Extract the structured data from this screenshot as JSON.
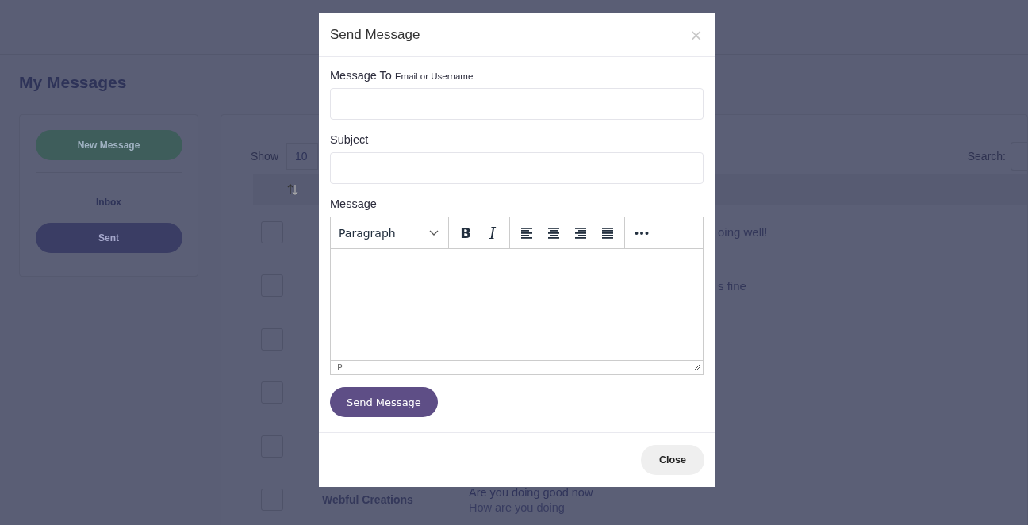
{
  "page": {
    "title": "My Messages",
    "sidebar": {
      "new_button": "New Message",
      "folders": [
        {
          "label": "Inbox",
          "selected": false
        },
        {
          "label": "Sent",
          "selected": true
        }
      ]
    },
    "table": {
      "show_label": "Show",
      "page_size": "10",
      "search_label": "Search:",
      "rows": [
        {
          "checked": false,
          "fragment": "oing well!"
        },
        {
          "checked": false,
          "fragment": "s fine"
        },
        {
          "checked": false
        },
        {
          "checked": false
        },
        {
          "checked": false
        },
        {
          "checked": false,
          "sender": "Webful Creations",
          "subject": "Are you doing good now",
          "preview": "How are you doing"
        }
      ]
    }
  },
  "modal": {
    "title": "Send Message",
    "close": "×",
    "fields": [
      {
        "label": "Message To",
        "hint": "Email or Username"
      },
      {
        "label": "Subject"
      }
    ],
    "message_label": "Message",
    "editor": {
      "block_format": "Paragraph",
      "bold": "B",
      "italic": "I",
      "status": "P"
    },
    "submit": "Send Message",
    "footer_button": "Close"
  }
}
